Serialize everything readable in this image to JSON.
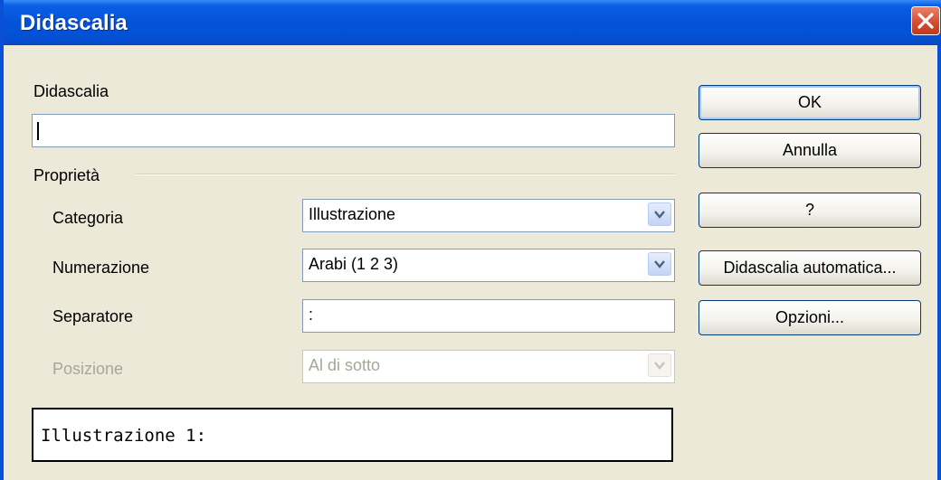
{
  "window": {
    "title": "Didascalia"
  },
  "caption": {
    "label": "Didascalia",
    "value": ""
  },
  "properties": {
    "group_label": "Proprietà",
    "category": {
      "label": "Categoria",
      "value": "Illustrazione"
    },
    "numbering": {
      "label": "Numerazione",
      "value": "Arabi (1 2 3)"
    },
    "separator": {
      "label": "Separatore",
      "value": ":"
    },
    "position": {
      "label": "Posizione",
      "value": "Al di sotto"
    }
  },
  "preview": {
    "text": "Illustrazione 1:"
  },
  "buttons": {
    "ok": "OK",
    "cancel": "Annulla",
    "help": "?",
    "autocaption": "Didascalia automatica...",
    "options": "Opzioni..."
  },
  "icons": {
    "close": "close-icon",
    "dropdown": "chevron-down-icon"
  },
  "colors": {
    "titlebar": "#0453d8",
    "close_button": "#d6482c",
    "dialog_bg": "#ece9d8"
  }
}
